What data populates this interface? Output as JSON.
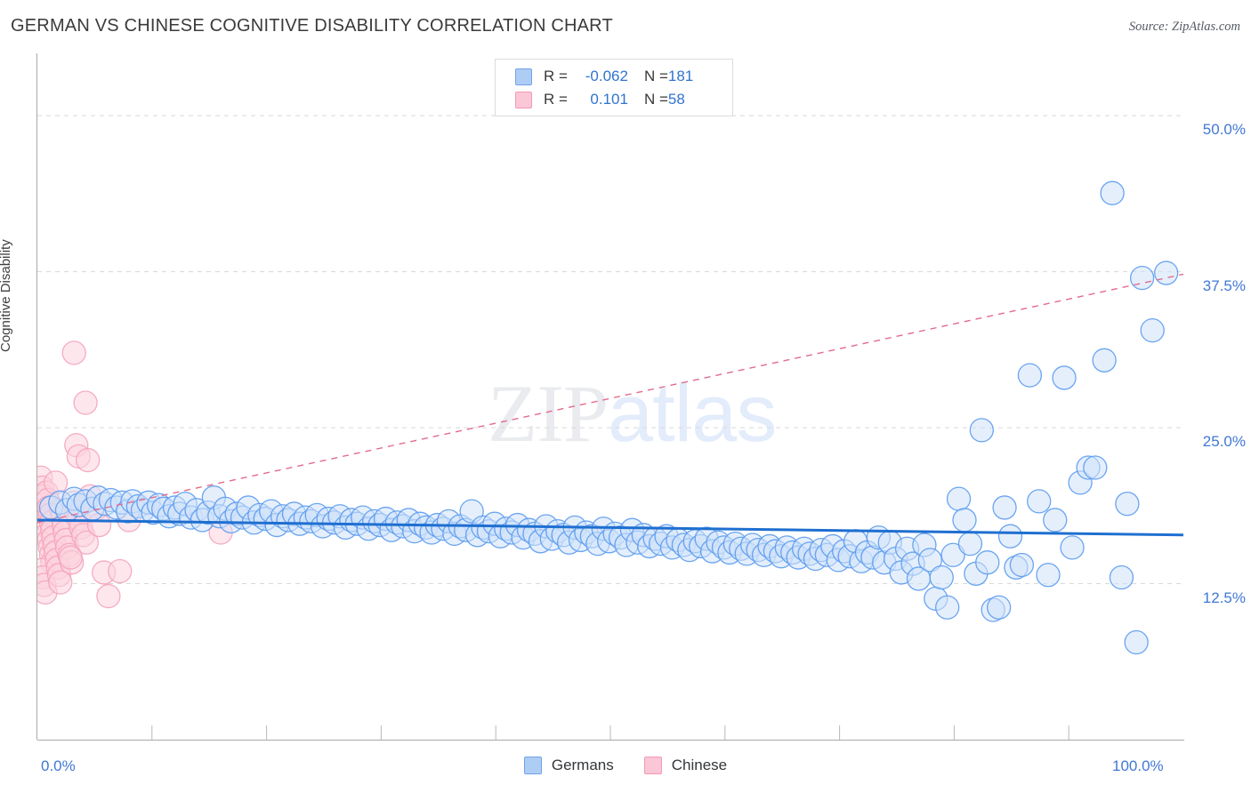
{
  "header": {
    "title": "GERMAN VS CHINESE COGNITIVE DISABILITY CORRELATION CHART",
    "source": "Source: ZipAtlas.com"
  },
  "watermark": {
    "part1": "ZIP",
    "part2": "atlas"
  },
  "stats": {
    "rows": [
      {
        "series": "Germans",
        "r_label": "R =",
        "r_value": "-0.062",
        "n_label": "N =",
        "n_value": "181",
        "color": "#aecdf4"
      },
      {
        "series": "Chinese",
        "r_label": "R =",
        "r_value": "0.101",
        "n_label": "N =",
        "n_value": "58",
        "color": "#fbc6d6"
      }
    ]
  },
  "legend": {
    "items": [
      {
        "label": "Germans",
        "color": "#aecdf4",
        "border": "#6fa3e8"
      },
      {
        "label": "Chinese",
        "color": "#fbc6d6",
        "border": "#f29ab6"
      }
    ]
  },
  "chart_data": {
    "type": "scatter",
    "title": "GERMAN VS CHINESE COGNITIVE DISABILITY CORRELATION CHART",
    "xlabel": "",
    "ylabel": "Cognitive Disability",
    "xlim": [
      0,
      100
    ],
    "ylim": [
      0,
      55
    ],
    "grid": true,
    "legend_position": "bottom",
    "xticks": [
      "0.0%",
      "100.0%"
    ],
    "xtick_values": [
      0,
      100
    ],
    "yticks": [
      "12.5%",
      "25.0%",
      "37.5%",
      "50.0%"
    ],
    "ytick_values": [
      12.5,
      25.0,
      37.5,
      50.0
    ],
    "series": [
      {
        "name": "Germans",
        "color": "#cfe2f9",
        "border": "#5b9bee",
        "r": -0.062,
        "n": 181,
        "trendline": {
          "style": "solid",
          "color": "#1f6fd0",
          "x0": 0,
          "y0": 17.6,
          "x1": 100,
          "y1": 16.4
        },
        "points": [
          [
            1.2,
            18.6
          ],
          [
            2.0,
            19.0
          ],
          [
            2.6,
            18.4
          ],
          [
            3.2,
            19.3
          ],
          [
            3.6,
            18.8
          ],
          [
            4.2,
            19.1
          ],
          [
            4.8,
            18.5
          ],
          [
            5.3,
            19.4
          ],
          [
            5.9,
            18.9
          ],
          [
            6.4,
            19.2
          ],
          [
            6.9,
            18.6
          ],
          [
            7.4,
            19.0
          ],
          [
            7.9,
            18.3
          ],
          [
            8.3,
            19.1
          ],
          [
            8.8,
            18.7
          ],
          [
            9.2,
            18.4
          ],
          [
            9.7,
            19.0
          ],
          [
            10.1,
            18.2
          ],
          [
            10.6,
            18.8
          ],
          [
            11.0,
            18.5
          ],
          [
            11.5,
            17.9
          ],
          [
            12.0,
            18.6
          ],
          [
            12.4,
            18.1
          ],
          [
            12.9,
            18.9
          ],
          [
            13.4,
            17.8
          ],
          [
            13.9,
            18.4
          ],
          [
            14.4,
            17.6
          ],
          [
            14.9,
            18.2
          ],
          [
            15.4,
            19.4
          ],
          [
            15.9,
            17.9
          ],
          [
            16.4,
            18.5
          ],
          [
            16.9,
            17.5
          ],
          [
            17.4,
            18.1
          ],
          [
            17.9,
            17.8
          ],
          [
            18.4,
            18.6
          ],
          [
            18.9,
            17.4
          ],
          [
            19.4,
            18.0
          ],
          [
            19.9,
            17.7
          ],
          [
            20.4,
            18.3
          ],
          [
            20.9,
            17.2
          ],
          [
            21.4,
            17.9
          ],
          [
            21.9,
            17.6
          ],
          [
            22.4,
            18.1
          ],
          [
            22.9,
            17.3
          ],
          [
            23.4,
            17.8
          ],
          [
            23.9,
            17.5
          ],
          [
            24.4,
            18.0
          ],
          [
            24.9,
            17.1
          ],
          [
            25.4,
            17.7
          ],
          [
            25.9,
            17.4
          ],
          [
            26.4,
            17.9
          ],
          [
            26.9,
            17.0
          ],
          [
            27.4,
            17.6
          ],
          [
            27.9,
            17.3
          ],
          [
            28.4,
            17.8
          ],
          [
            28.9,
            16.9
          ],
          [
            29.4,
            17.5
          ],
          [
            29.9,
            17.2
          ],
          [
            30.4,
            17.7
          ],
          [
            30.9,
            16.8
          ],
          [
            31.4,
            17.4
          ],
          [
            31.9,
            17.1
          ],
          [
            32.4,
            17.6
          ],
          [
            32.9,
            16.7
          ],
          [
            33.4,
            17.3
          ],
          [
            33.9,
            17.0
          ],
          [
            34.4,
            16.6
          ],
          [
            34.9,
            17.2
          ],
          [
            35.4,
            16.9
          ],
          [
            35.9,
            17.5
          ],
          [
            36.4,
            16.5
          ],
          [
            36.9,
            17.1
          ],
          [
            37.4,
            16.8
          ],
          [
            37.9,
            18.3
          ],
          [
            38.4,
            16.4
          ],
          [
            38.9,
            17.0
          ],
          [
            39.4,
            16.7
          ],
          [
            39.9,
            17.3
          ],
          [
            40.4,
            16.3
          ],
          [
            40.9,
            16.9
          ],
          [
            41.4,
            16.6
          ],
          [
            41.9,
            17.2
          ],
          [
            42.4,
            16.2
          ],
          [
            42.9,
            16.8
          ],
          [
            43.4,
            16.5
          ],
          [
            43.9,
            15.9
          ],
          [
            44.4,
            17.1
          ],
          [
            44.9,
            16.1
          ],
          [
            45.4,
            16.7
          ],
          [
            45.9,
            16.4
          ],
          [
            46.4,
            15.8
          ],
          [
            46.9,
            17.0
          ],
          [
            47.4,
            16.0
          ],
          [
            47.9,
            16.6
          ],
          [
            48.4,
            16.3
          ],
          [
            48.9,
            15.7
          ],
          [
            49.4,
            16.9
          ],
          [
            49.9,
            15.9
          ],
          [
            50.4,
            16.5
          ],
          [
            50.9,
            16.2
          ],
          [
            51.4,
            15.6
          ],
          [
            51.9,
            16.8
          ],
          [
            52.4,
            15.8
          ],
          [
            52.9,
            16.4
          ],
          [
            53.4,
            15.5
          ],
          [
            53.9,
            16.1
          ],
          [
            54.4,
            15.7
          ],
          [
            54.9,
            16.3
          ],
          [
            55.4,
            15.4
          ],
          [
            55.9,
            16.0
          ],
          [
            56.4,
            15.6
          ],
          [
            56.9,
            15.2
          ],
          [
            57.4,
            15.9
          ],
          [
            57.9,
            15.5
          ],
          [
            58.4,
            16.1
          ],
          [
            58.9,
            15.1
          ],
          [
            59.4,
            15.8
          ],
          [
            59.9,
            15.4
          ],
          [
            60.4,
            15.0
          ],
          [
            60.9,
            15.7
          ],
          [
            61.4,
            15.3
          ],
          [
            61.9,
            14.9
          ],
          [
            62.4,
            15.6
          ],
          [
            62.9,
            15.2
          ],
          [
            63.4,
            14.8
          ],
          [
            63.9,
            15.5
          ],
          [
            64.4,
            15.1
          ],
          [
            64.9,
            14.7
          ],
          [
            65.4,
            15.4
          ],
          [
            65.9,
            15.0
          ],
          [
            66.4,
            14.6
          ],
          [
            66.9,
            15.3
          ],
          [
            67.4,
            14.9
          ],
          [
            67.9,
            14.5
          ],
          [
            68.4,
            15.2
          ],
          [
            68.9,
            14.8
          ],
          [
            69.4,
            15.5
          ],
          [
            69.9,
            14.4
          ],
          [
            70.4,
            15.1
          ],
          [
            70.9,
            14.7
          ],
          [
            71.4,
            15.9
          ],
          [
            71.9,
            14.3
          ],
          [
            72.4,
            15.0
          ],
          [
            72.9,
            14.6
          ],
          [
            73.4,
            16.2
          ],
          [
            73.9,
            14.2
          ],
          [
            74.4,
            15.8
          ],
          [
            74.9,
            14.5
          ],
          [
            75.4,
            13.4
          ],
          [
            75.9,
            15.3
          ],
          [
            76.4,
            14.1
          ],
          [
            76.9,
            12.9
          ],
          [
            77.4,
            15.6
          ],
          [
            77.9,
            14.4
          ],
          [
            78.4,
            11.3
          ],
          [
            78.9,
            13.0
          ],
          [
            79.4,
            10.6
          ],
          [
            79.9,
            14.8
          ],
          [
            80.4,
            19.3
          ],
          [
            80.9,
            17.6
          ],
          [
            81.4,
            15.7
          ],
          [
            81.9,
            13.3
          ],
          [
            82.4,
            24.8
          ],
          [
            82.9,
            14.2
          ],
          [
            83.4,
            10.4
          ],
          [
            83.9,
            10.6
          ],
          [
            84.4,
            18.6
          ],
          [
            84.9,
            16.3
          ],
          [
            85.4,
            13.8
          ],
          [
            85.9,
            14.0
          ],
          [
            86.6,
            29.2
          ],
          [
            87.4,
            19.1
          ],
          [
            88.2,
            13.2
          ],
          [
            88.8,
            17.6
          ],
          [
            89.6,
            29.0
          ],
          [
            90.3,
            15.4
          ],
          [
            91.0,
            20.6
          ],
          [
            91.7,
            21.8
          ],
          [
            92.3,
            21.8
          ],
          [
            93.1,
            30.4
          ],
          [
            93.8,
            43.8
          ],
          [
            94.6,
            13.0
          ],
          [
            95.1,
            18.9
          ],
          [
            95.9,
            7.8
          ],
          [
            96.4,
            37.0
          ],
          [
            97.3,
            32.8
          ],
          [
            98.5,
            37.4
          ]
        ]
      },
      {
        "name": "Chinese",
        "color": "#fbd3df",
        "border": "#f4a3bd",
        "r": 0.101,
        "n": 58,
        "trendline": {
          "style": "dashed",
          "color": "#e36b8c",
          "x0": 0,
          "y0": 17.4,
          "x1": 100,
          "y1": 37.3
        },
        "points": [
          [
            0.3,
            21.0
          ],
          [
            0.4,
            20.2
          ],
          [
            0.5,
            19.5
          ],
          [
            0.5,
            18.8
          ],
          [
            0.6,
            18.2
          ],
          [
            0.7,
            17.6
          ],
          [
            0.8,
            17.1
          ],
          [
            0.9,
            16.5
          ],
          [
            1.0,
            16.0
          ],
          [
            1.1,
            15.4
          ],
          [
            1.2,
            14.8
          ],
          [
            1.3,
            14.2
          ],
          [
            0.4,
            13.6
          ],
          [
            0.5,
            13.0
          ],
          [
            0.6,
            12.4
          ],
          [
            0.7,
            11.8
          ],
          [
            0.8,
            19.8
          ],
          [
            0.9,
            19.2
          ],
          [
            1.0,
            18.6
          ],
          [
            1.1,
            18.0
          ],
          [
            1.2,
            17.4
          ],
          [
            1.3,
            16.8
          ],
          [
            1.4,
            16.2
          ],
          [
            1.5,
            15.6
          ],
          [
            1.6,
            15.0
          ],
          [
            1.7,
            14.4
          ],
          [
            1.8,
            13.8
          ],
          [
            1.9,
            13.2
          ],
          [
            2.0,
            12.6
          ],
          [
            2.1,
            18.4
          ],
          [
            2.2,
            17.8
          ],
          [
            2.3,
            17.2
          ],
          [
            2.4,
            16.6
          ],
          [
            2.5,
            16.0
          ],
          [
            2.6,
            15.4
          ],
          [
            2.8,
            14.8
          ],
          [
            3.0,
            14.2
          ],
          [
            3.2,
            19.0
          ],
          [
            3.4,
            18.3
          ],
          [
            3.6,
            17.7
          ],
          [
            3.8,
            17.0
          ],
          [
            4.0,
            16.4
          ],
          [
            4.3,
            15.8
          ],
          [
            4.6,
            19.5
          ],
          [
            5.0,
            18.4
          ],
          [
            5.4,
            17.2
          ],
          [
            5.8,
            13.4
          ],
          [
            6.2,
            11.5
          ],
          [
            3.4,
            23.6
          ],
          [
            3.6,
            22.7
          ],
          [
            4.4,
            22.4
          ],
          [
            4.2,
            27.0
          ],
          [
            3.2,
            31.0
          ],
          [
            7.2,
            13.5
          ],
          [
            8.0,
            17.6
          ],
          [
            16.0,
            16.6
          ],
          [
            2.9,
            14.6
          ],
          [
            1.6,
            20.6
          ]
        ]
      }
    ]
  },
  "yaxis_title": "Cognitive Disability"
}
